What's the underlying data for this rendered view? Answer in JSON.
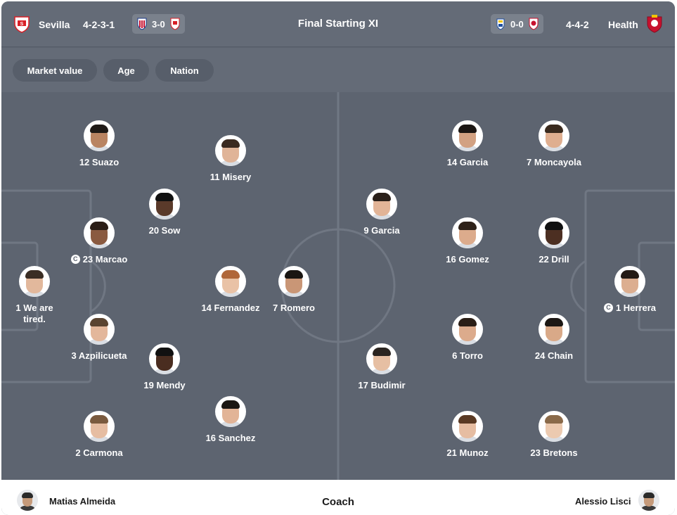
{
  "header": {
    "title": "Final Starting XI",
    "home": {
      "name": "Sevilla",
      "formation": "4-2-3-1",
      "last_result": "3-0",
      "crest_color": "#d91f26"
    },
    "away": {
      "name": "Health",
      "formation": "4-4-2",
      "last_result": "0-0",
      "crest_color": "#c8102e"
    }
  },
  "filters": [
    "Market value",
    "Age",
    "Nation"
  ],
  "home_players": [
    {
      "label": "12 Suazo",
      "captain": false,
      "skin": "#b98462",
      "hair": "#1f1a17"
    },
    {
      "label": "11 Misery",
      "captain": false,
      "skin": "#e0b498",
      "hair": "#3a2a20"
    },
    {
      "label": "20 Sow",
      "captain": false,
      "skin": "#5a3a2a",
      "hair": "#111111"
    },
    {
      "label": "23 Marcao",
      "captain": true,
      "skin": "#8a5a40",
      "hair": "#2a1d16"
    },
    {
      "label": "1 We are tired.",
      "captain": false,
      "skin": "#e2b89c",
      "hair": "#3a2d24"
    },
    {
      "label": "14 Fernandez",
      "captain": false,
      "skin": "#e9c2a6",
      "hair": "#b0673a"
    },
    {
      "label": "7 Romero",
      "captain": false,
      "skin": "#c99676",
      "hair": "#1a1612"
    },
    {
      "label": "3 Azpilicueta",
      "captain": false,
      "skin": "#e3b79b",
      "hair": "#5a4431"
    },
    {
      "label": "19 Mendy",
      "captain": false,
      "skin": "#4a2d20",
      "hair": "#111111"
    },
    {
      "label": "2 Carmona",
      "captain": false,
      "skin": "#e6bda2",
      "hair": "#7a5a3e"
    },
    {
      "label": "16 Sanchez",
      "captain": false,
      "skin": "#e2b497",
      "hair": "#1a1612"
    }
  ],
  "away_players": [
    {
      "label": "14 Garcia",
      "captain": false,
      "skin": "#d2a182",
      "hair": "#1c1714"
    },
    {
      "label": "7 Moncayola",
      "captain": false,
      "skin": "#dfae8f",
      "hair": "#3a2a1e"
    },
    {
      "label": "9 Garcia",
      "captain": false,
      "skin": "#e2b497",
      "hair": "#2a201a"
    },
    {
      "label": "16 Gomez",
      "captain": false,
      "skin": "#dcab8c",
      "hair": "#2e2219"
    },
    {
      "label": "22 Drill",
      "captain": false,
      "skin": "#4c2f22",
      "hair": "#111111"
    },
    {
      "label": "1 Herrera",
      "captain": true,
      "skin": "#dcae90",
      "hair": "#241b15"
    },
    {
      "label": "17 Budimir",
      "captain": false,
      "skin": "#e6bfa3",
      "hair": "#2a2420"
    },
    {
      "label": "6 Torro",
      "captain": false,
      "skin": "#dcab8c",
      "hair": "#2a1e16"
    },
    {
      "label": "24 Chain",
      "captain": false,
      "skin": "#d9a988",
      "hair": "#1c1714"
    },
    {
      "label": "21 Munoz",
      "captain": false,
      "skin": "#e6bda2",
      "hair": "#5a3a24"
    },
    {
      "label": "23 Bretons",
      "captain": false,
      "skin": "#eccab0",
      "hair": "#8a6a4a"
    }
  ],
  "coaches": {
    "label": "Coach",
    "home": "Matias Almeida",
    "away": "Alessio Lisci"
  },
  "colors": {
    "pitch": "#5d6470",
    "header": "#646b77",
    "lines": "#707783"
  }
}
